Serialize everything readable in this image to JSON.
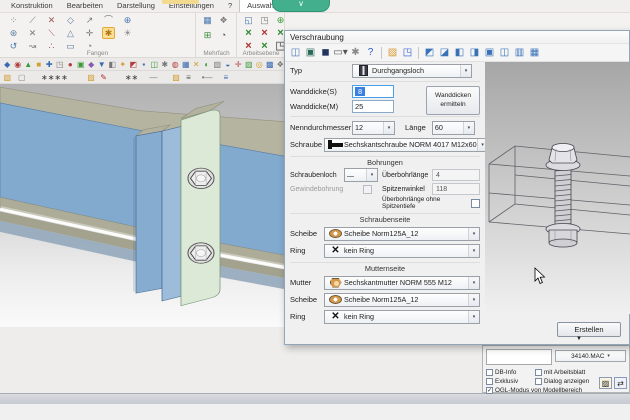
{
  "overlay": {
    "chevron": "∨",
    "dropdown_marker": "▼"
  },
  "menu": {
    "items": [
      {
        "label": "Konstruktion"
      },
      {
        "label": "Bearbeiten"
      },
      {
        "label": "Darstellung"
      },
      {
        "label": "Einstellungen"
      },
      {
        "label": "?"
      },
      {
        "label": "Auswahl",
        "active": true
      }
    ]
  },
  "ribbon": {
    "groups": {
      "fangen": "Fangen",
      "mehrfach": "Mehrfach",
      "arbeitsebene": "Arbeitsebene"
    },
    "fangen_rows": [
      [
        {
          "g": "⁘",
          "c": "#6b7f93"
        },
        {
          "g": "⟋",
          "c": "#7a7a7a"
        },
        {
          "g": "✕",
          "c": "#9a5a5a"
        },
        {
          "g": "◇",
          "c": "#5a7da0"
        },
        {
          "g": "↗",
          "c": "#7a7a7a"
        },
        {
          "g": "⌒",
          "c": "#7a7a7a"
        },
        {
          "g": "⊕",
          "c": "#4a7ab0"
        }
      ],
      [
        {
          "g": "⊛",
          "c": "#5a7da0"
        },
        {
          "g": "✕",
          "c": "#7a7a7a"
        },
        {
          "g": "⟍",
          "c": "#9a5a5a"
        },
        {
          "g": "△",
          "c": "#5a7da0"
        },
        {
          "g": "✛",
          "c": "#7a7a7a"
        },
        {
          "g": "✱",
          "c": "#b07818",
          "hl": true
        },
        {
          "g": "☀",
          "c": "#8a8a8a"
        }
      ],
      [
        {
          "g": "↺",
          "c": "#4a7ab0"
        },
        {
          "g": "↝",
          "c": "#7a7a7a"
        },
        {
          "g": "∴",
          "c": "#9a5a5a"
        },
        {
          "g": "▭",
          "c": "#5a7da0"
        },
        {
          "g": "◔",
          "c": "#7a7a7a"
        }
      ]
    ],
    "mehrfach_icons": [
      {
        "g": "▦",
        "c": "#4a7ab0"
      },
      {
        "g": "❖",
        "c": "#7a7a7a"
      },
      {
        "g": "⊞",
        "c": "#3a8a3a"
      },
      {
        "g": "◔",
        "c": "#555555"
      }
    ],
    "arbeitsebene_rows": [
      [
        {
          "g": "◱",
          "c": "#4a7ab0"
        },
        {
          "g": "◳",
          "c": "#7a7a7a"
        },
        {
          "g": "⊕",
          "c": "#3a9a3a"
        }
      ],
      [
        {
          "g": "×",
          "c": "#2e8b2e"
        },
        {
          "g": "×",
          "c": "#b03030"
        },
        {
          "g": "×",
          "c": "#2e8b2e"
        }
      ],
      [
        {
          "g": "×",
          "c": "#b03030"
        },
        {
          "g": "×",
          "c": "#2e8b2e"
        },
        {
          "g": "◳",
          "c": "#777777"
        }
      ]
    ]
  },
  "strip_a": [
    {
      "g": "◆",
      "c": "#3a6ab0"
    },
    {
      "g": "◉",
      "c": "#b04040"
    },
    {
      "g": "▲",
      "c": "#3a9a3a"
    },
    {
      "g": "■",
      "c": "#d0a030"
    },
    {
      "g": "✚",
      "c": "#3a6ab0"
    },
    {
      "g": "◳",
      "c": "#777777"
    },
    {
      "g": "●",
      "c": "#b04040"
    },
    {
      "g": "▣",
      "c": "#3a9a3a"
    },
    {
      "g": "◆",
      "c": "#8a5ab0"
    },
    {
      "g": "▼",
      "c": "#3a6ab0"
    },
    {
      "g": "◧",
      "c": "#777777"
    },
    {
      "g": "✦",
      "c": "#d0a030"
    },
    {
      "g": "◩",
      "c": "#b04040"
    },
    {
      "g": "▪",
      "c": "#3a6ab0"
    },
    {
      "g": "◫",
      "c": "#3a9a3a"
    },
    {
      "g": "✱",
      "c": "#777777"
    },
    {
      "g": "◍",
      "c": "#b04040"
    },
    {
      "g": "▦",
      "c": "#3a6ab0"
    },
    {
      "g": "✕",
      "c": "#d0a030"
    },
    {
      "g": "◐",
      "c": "#3a9a3a"
    },
    {
      "g": "▧",
      "c": "#777777"
    },
    {
      "g": "◒",
      "c": "#3a6ab0"
    },
    {
      "g": "✛",
      "c": "#b04040"
    },
    {
      "g": "▨",
      "c": "#3a9a3a"
    },
    {
      "g": "◎",
      "c": "#d0a030"
    },
    {
      "g": "▩",
      "c": "#3a6ab0"
    },
    {
      "g": "❖",
      "c": "#777777"
    }
  ],
  "strip_b": [
    {
      "g": "▨",
      "c": "#d09a2a"
    },
    {
      "g": "▢",
      "c": "#888888",
      "gap": 4
    },
    {
      "g": "∗∗∗∗",
      "c": "#444444",
      "gap": 14
    },
    {
      "g": "▨",
      "c": "#d09a2a",
      "gap": 18
    },
    {
      "g": "✎",
      "c": "#b03030",
      "gap": 2
    },
    {
      "g": "∗∗",
      "c": "#444444",
      "gap": 16
    },
    {
      "g": "—",
      "c": "#777777",
      "gap": 10
    },
    {
      "g": "▨",
      "c": "#d09a2a",
      "gap": 12
    },
    {
      "g": "≡",
      "c": "#555555",
      "gap": 2
    },
    {
      "g": "•—",
      "c": "#777777",
      "gap": 8
    },
    {
      "g": "≡",
      "c": "#3a6ab0",
      "gap": 8
    }
  ],
  "dialog": {
    "title": "Verschraubung",
    "toolbar_icons": [
      {
        "g": "◫",
        "c": "#4a7ab0"
      },
      {
        "g": "▣",
        "c": "#2a6a5a"
      },
      {
        "g": "◼",
        "c": "#22355f"
      },
      {
        "g": "▭▾",
        "c": "#555555"
      },
      {
        "g": "✱",
        "c": "#888888"
      },
      {
        "g": "?",
        "c": "#2a5ad0"
      },
      {
        "sep": true
      },
      {
        "g": "▨",
        "c": "#d89a32"
      },
      {
        "g": "◳",
        "c": "#2a5ad0"
      },
      {
        "sep": true
      },
      {
        "g": "◩",
        "c": "#3a72b8"
      },
      {
        "g": "◪",
        "c": "#3a72b8"
      },
      {
        "g": "◧",
        "c": "#3a72b8"
      },
      {
        "g": "◨",
        "c": "#3a72b8"
      },
      {
        "g": "▣",
        "c": "#3a72b8"
      },
      {
        "g": "◫",
        "c": "#3a72b8"
      },
      {
        "g": "▥",
        "c": "#3a72b8"
      },
      {
        "g": "▦",
        "c": "#3a72b8"
      }
    ],
    "typ_label": "Typ",
    "typ_value": "Durchgangsloch",
    "wanddicke_s_label": "Wanddicke(S)",
    "wanddicke_s_value": "8",
    "wanddicke_m_label": "Wanddicke(M)",
    "wanddicke_m_value": "25",
    "wanddicken_button": "Wanddicken ermitteln",
    "nenndurchmesser_label": "Nenndurchmesser",
    "nenndurchmesser_value": "12",
    "laenge_label": "Länge",
    "laenge_value": "60",
    "schraube_label": "Schraube",
    "schraube_value": "Sechskantschraube NORM 4017 M12x60",
    "bohrungen": {
      "header": "Bohrungen",
      "schraubenloch_label": "Schraubenloch",
      "schraubenloch_value": "—",
      "gewindebohrung_label": "Gewindebohrung",
      "ueberbohrlaenge_label": "Überbohrlänge",
      "ueberbohrlaenge_value": "4",
      "spitzenwinkel_label": "Spitzenwinkel",
      "spitzenwinkel_value": "118",
      "ohne_spitzentiefe_label": "Überbohrlänge ohne Spitzentiefe"
    },
    "schraubenseite": {
      "header": "Schraubenseite",
      "scheibe_label": "Scheibe",
      "scheibe_value": "Scheibe Norm125A_12",
      "ring_label": "Ring",
      "ring_value": "kein Ring"
    },
    "mutternseite": {
      "header": "Mutternseite",
      "mutter_label": "Mutter",
      "mutter_value": "Sechskantmutter NORM 555 M12",
      "scheibe_label": "Scheibe",
      "scheibe_value": "Scheibe Norm125A_12",
      "ring_label": "Ring",
      "ring_value": "kein Ring"
    },
    "create_button": "Erstellen"
  },
  "macro_panel": {
    "file": "34140.MAC",
    "checkboxes": [
      {
        "label": "DB-Info",
        "checked": false
      },
      {
        "label": "mit Arbeitsblatt",
        "checked": false
      },
      {
        "label": "Exklusiv",
        "checked": false
      },
      {
        "label": "Dialog anzeigen",
        "checked": false
      },
      {
        "label": "OGL-Modus von Modellbereich",
        "checked": true
      }
    ],
    "buttons": [
      {
        "g": "▨",
        "c": "#c8a030"
      },
      {
        "g": "⇄",
        "c": "#2255cc"
      }
    ]
  },
  "colors": {
    "pill_green": "#43af8d",
    "highlight_yellow": "#fbdf96",
    "beam_web_blue": "#82aacf",
    "flange_tan": "#b5b4a0",
    "plate_green": "#dbe9d6",
    "selection_blue": "#3a80e0"
  }
}
